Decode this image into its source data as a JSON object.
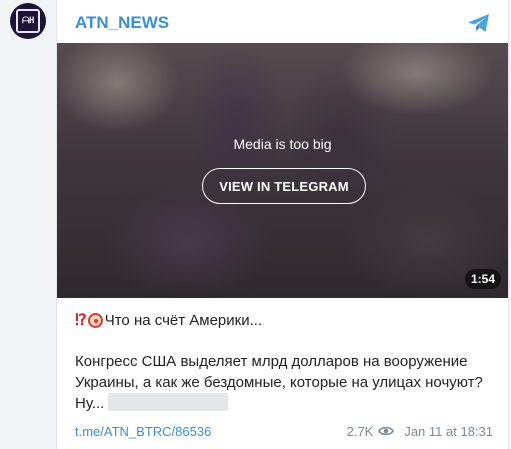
{
  "avatar": {
    "text": "ᗩH"
  },
  "post": {
    "channel": "ATN_NEWS",
    "media": {
      "message": "Media is too big",
      "button_label": "VIEW IN TELEGRAM",
      "duration": "1:54"
    },
    "title": "Что на счёт Америки...",
    "body": "Конгресс США выделяет млрд долларов на вооружение Украины, а как же бездомные, которые на улицах ночуют? Ну...",
    "link": "t.me/ATN_BTRC/86536",
    "views": "2.7K",
    "date": "Jan 11 at 18:31"
  },
  "icons": {
    "avatar": "channel-logo-icon",
    "telegram": "telegram-plane-icon",
    "title_emojis": [
      "double-exclamation-icon",
      "clown-face-icon"
    ],
    "views": "eye-icon"
  },
  "colors": {
    "accent": "#3a8fd2",
    "avatar_bg": "#1d1336",
    "text": "#222222",
    "muted": "#7b8790"
  }
}
